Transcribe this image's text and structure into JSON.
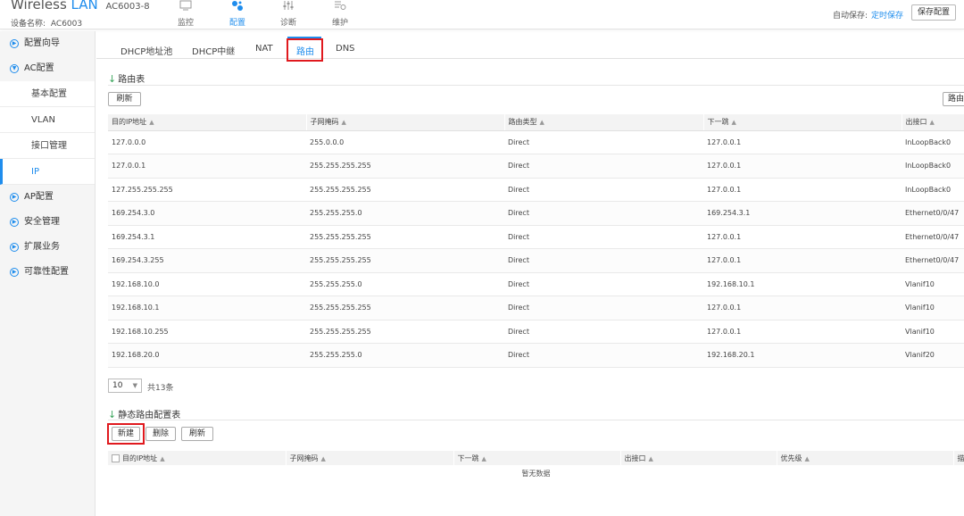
{
  "header": {
    "brand_wireless": "Wireless",
    "brand_lan": "LAN",
    "model": "AC6003-8",
    "device_label": "设备名称:",
    "device_name": "AC6003",
    "nav": [
      {
        "label": "监控",
        "icon": "monitor-icon"
      },
      {
        "label": "配置",
        "icon": "config-gear-icon"
      },
      {
        "label": "诊断",
        "icon": "diagnose-icon"
      },
      {
        "label": "维护",
        "icon": "maintain-icon"
      }
    ],
    "autosave_label": "自动保存:",
    "autosave_link": "定时保存",
    "save_button": "保存配置"
  },
  "sidebar": {
    "items": [
      {
        "label": "配置向导"
      },
      {
        "label": "AC配置"
      },
      {
        "label": "AP配置"
      },
      {
        "label": "安全管理"
      },
      {
        "label": "扩展业务"
      },
      {
        "label": "可靠性配置"
      }
    ],
    "ac_sub": [
      {
        "label": "基本配置"
      },
      {
        "label": "VLAN"
      },
      {
        "label": "接口管理"
      },
      {
        "label": "IP"
      }
    ]
  },
  "tabs": [
    "DHCP地址池",
    "DHCP中继",
    "NAT",
    "路由",
    "DNS"
  ],
  "route_table": {
    "title": "路由表",
    "refresh": "刷新",
    "right_button": "路由",
    "columns": [
      "目的IP地址",
      "子网掩码",
      "路由类型",
      "下一跳",
      "出接口"
    ],
    "rows": [
      [
        "127.0.0.0",
        "255.0.0.0",
        "Direct",
        "127.0.0.1",
        "InLoopBack0"
      ],
      [
        "127.0.0.1",
        "255.255.255.255",
        "Direct",
        "127.0.0.1",
        "InLoopBack0"
      ],
      [
        "127.255.255.255",
        "255.255.255.255",
        "Direct",
        "127.0.0.1",
        "InLoopBack0"
      ],
      [
        "169.254.3.0",
        "255.255.255.0",
        "Direct",
        "169.254.3.1",
        "Ethernet0/0/47"
      ],
      [
        "169.254.3.1",
        "255.255.255.255",
        "Direct",
        "127.0.0.1",
        "Ethernet0/0/47"
      ],
      [
        "169.254.3.255",
        "255.255.255.255",
        "Direct",
        "127.0.0.1",
        "Ethernet0/0/47"
      ],
      [
        "192.168.10.0",
        "255.255.255.0",
        "Direct",
        "192.168.10.1",
        "Vlanif10"
      ],
      [
        "192.168.10.1",
        "255.255.255.255",
        "Direct",
        "127.0.0.1",
        "Vlanif10"
      ],
      [
        "192.168.10.255",
        "255.255.255.255",
        "Direct",
        "127.0.0.1",
        "Vlanif10"
      ],
      [
        "192.168.20.0",
        "255.255.255.0",
        "Direct",
        "192.168.20.1",
        "Vlanif20"
      ]
    ],
    "page_size": "10",
    "total": "共13条"
  },
  "static_route": {
    "title": "静态路由配置表",
    "new_button": "新建",
    "delete_button": "删除",
    "refresh_button": "刷新",
    "columns": [
      "目的IP地址",
      "子网掩码",
      "下一跳",
      "出接口",
      "优先级",
      "描"
    ],
    "empty": "暂无数据"
  },
  "colors": {
    "accent": "#1f8ded",
    "highlight": "#e0191e"
  }
}
